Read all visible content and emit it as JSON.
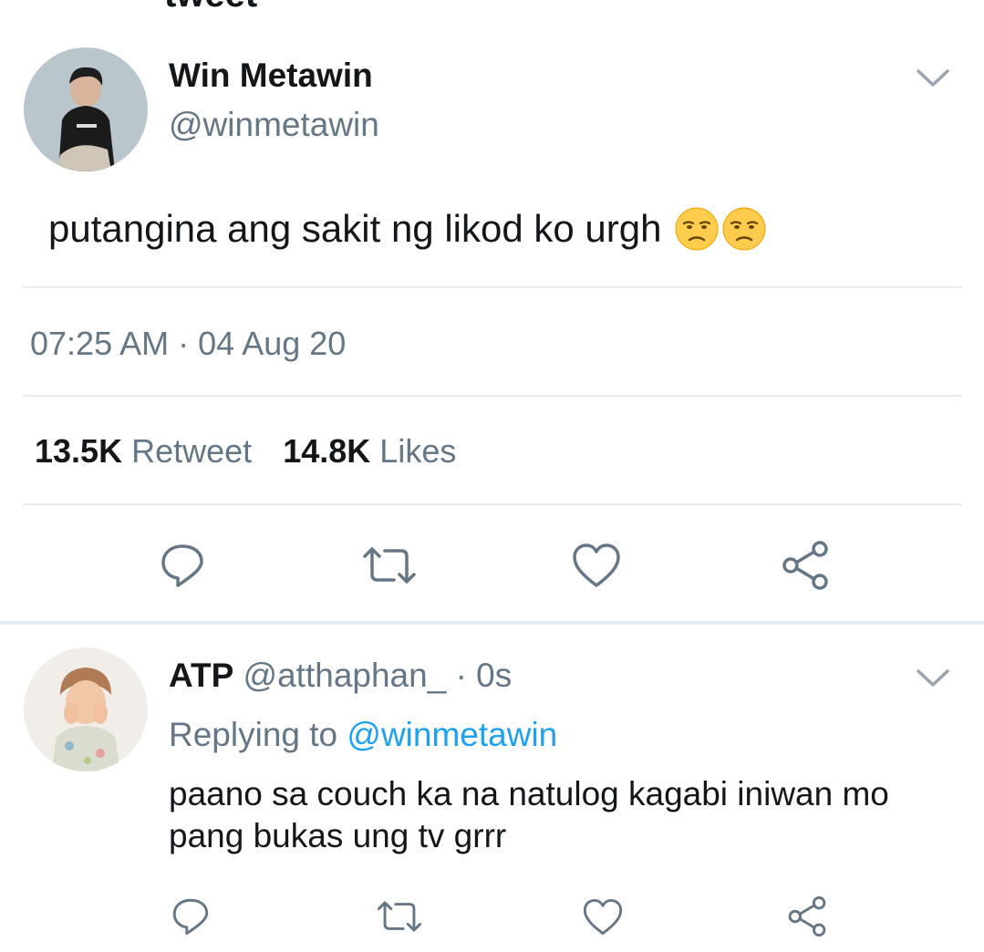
{
  "header": {
    "title_fragment": "tweet"
  },
  "main_tweet": {
    "author_name": "Win Metawin",
    "author_handle": "@winmetawin",
    "text": "putangina ang sakit ng likod ko urgh",
    "emoji": [
      "unamused-face",
      "unamused-face"
    ],
    "time": "07:25 AM",
    "separator": "·",
    "date": "04 Aug 20",
    "retweet_count": "13.5K",
    "retweet_label": "Retweet",
    "like_count": "14.8K",
    "like_label": "Likes",
    "actions": [
      "reply-icon",
      "retweet-icon",
      "like-icon",
      "share-icon"
    ]
  },
  "reply": {
    "author_name": "ATP",
    "author_handle": "@atthaphan_",
    "meta": "· 0s",
    "replying_prefix": "Replying to",
    "replying_handle": "@winmetawin",
    "text": "paano sa couch ka na natulog kagabi iniwan mo pang bukas ung tv grrr",
    "actions": [
      "reply-icon",
      "retweet-icon",
      "like-icon",
      "share-icon"
    ]
  },
  "colors": {
    "text": "#14171a",
    "muted": "#657786",
    "link": "#1da1f2",
    "divider": "#e6ecf0",
    "icon": "#657786"
  }
}
